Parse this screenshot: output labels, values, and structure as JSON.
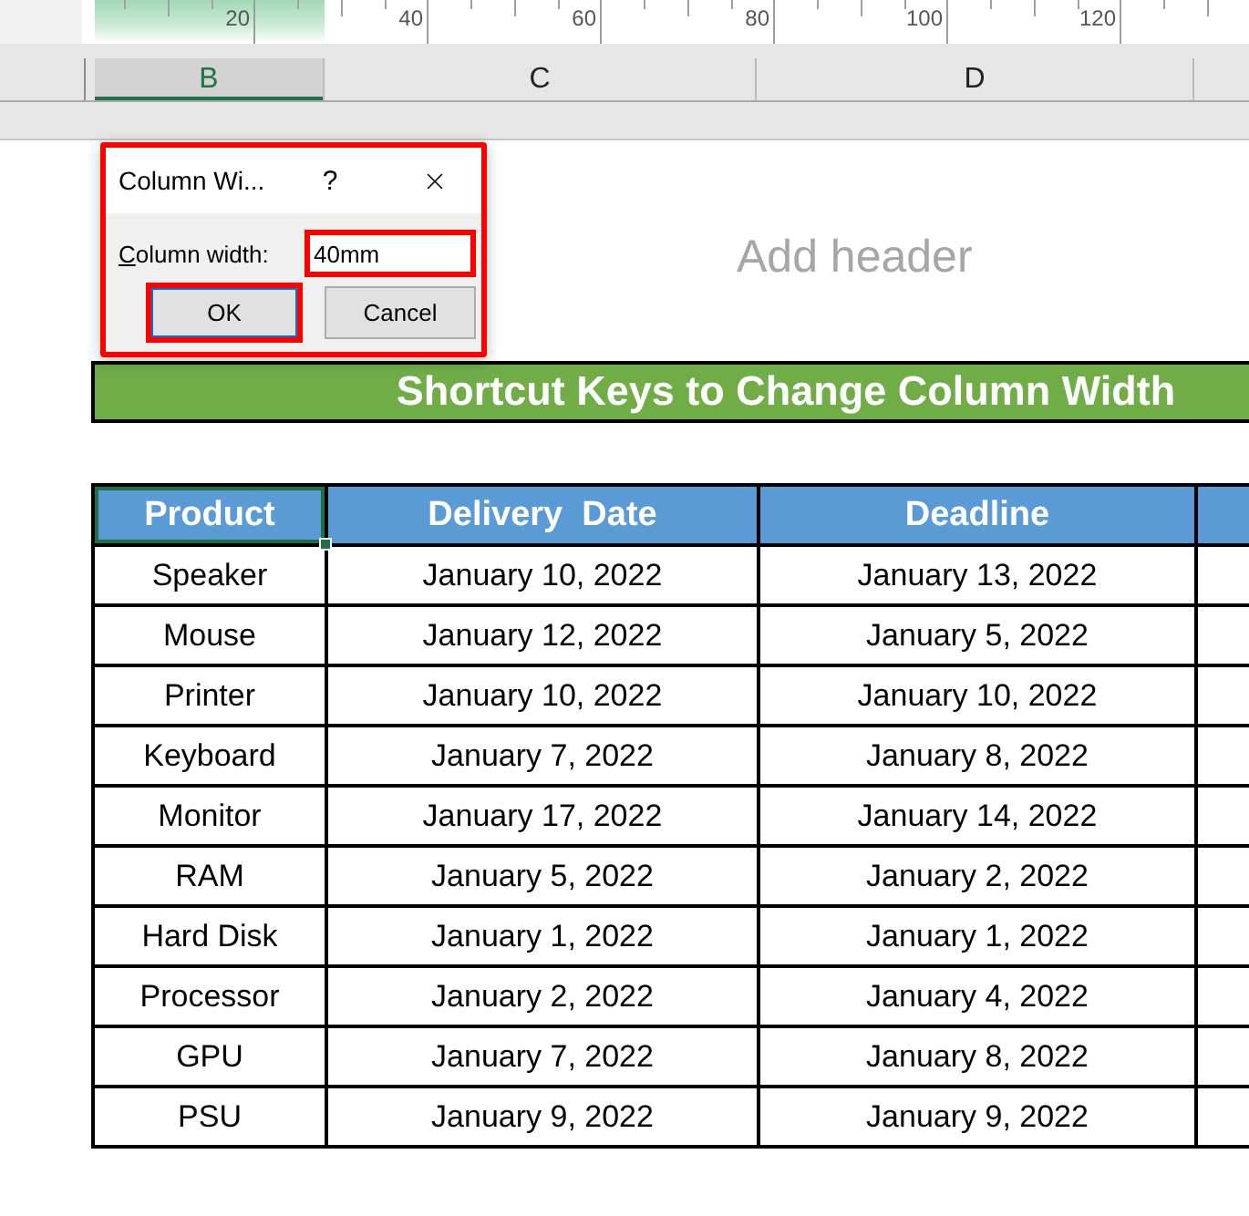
{
  "ruler": {
    "numbers": [
      "20",
      "40",
      "60",
      "80",
      "100",
      "120"
    ]
  },
  "column_headers": [
    {
      "label": "B",
      "selected": true
    },
    {
      "label": "C",
      "selected": false
    },
    {
      "label": "D",
      "selected": false
    }
  ],
  "page": {
    "header_placeholder": "Add header"
  },
  "dialog": {
    "title": "Column Wi...",
    "help": "?",
    "highlighted": true,
    "field": {
      "label": "Column width:",
      "mnemonic_underlined": true,
      "value": "40mm",
      "highlighted": true
    },
    "buttons": [
      {
        "label": "OK",
        "default": true,
        "highlighted": true
      },
      {
        "label": "Cancel",
        "default": false,
        "highlighted": false
      }
    ]
  },
  "banner": {
    "title": "Shortcut Keys to Change Column Width"
  },
  "table": {
    "columns": [
      {
        "label": "Product",
        "selected": true
      },
      {
        "label": "Delivery  Date",
        "selected": false
      },
      {
        "label": "Deadline",
        "selected": false
      }
    ],
    "rows": [
      [
        "Speaker",
        "January 10, 2022",
        "January 13, 2022"
      ],
      [
        "Mouse",
        "January 12, 2022",
        "January 5, 2022"
      ],
      [
        "Printer",
        "January 10, 2022",
        "January 10, 2022"
      ],
      [
        "Keyboard",
        "January 7, 2022",
        "January 8, 2022"
      ],
      [
        "Monitor",
        "January 17, 2022",
        "January 14, 2022"
      ],
      [
        "RAM",
        "January 5, 2022",
        "January 2, 2022"
      ],
      [
        "Hard Disk",
        "January 1, 2022",
        "January 1, 2022"
      ],
      [
        "Processor",
        "January 2, 2022",
        "January 4, 2022"
      ],
      [
        "GPU",
        "January 7, 2022",
        "January 8, 2022"
      ],
      [
        "PSU",
        "January 9, 2022",
        "January 9, 2022"
      ]
    ]
  }
}
